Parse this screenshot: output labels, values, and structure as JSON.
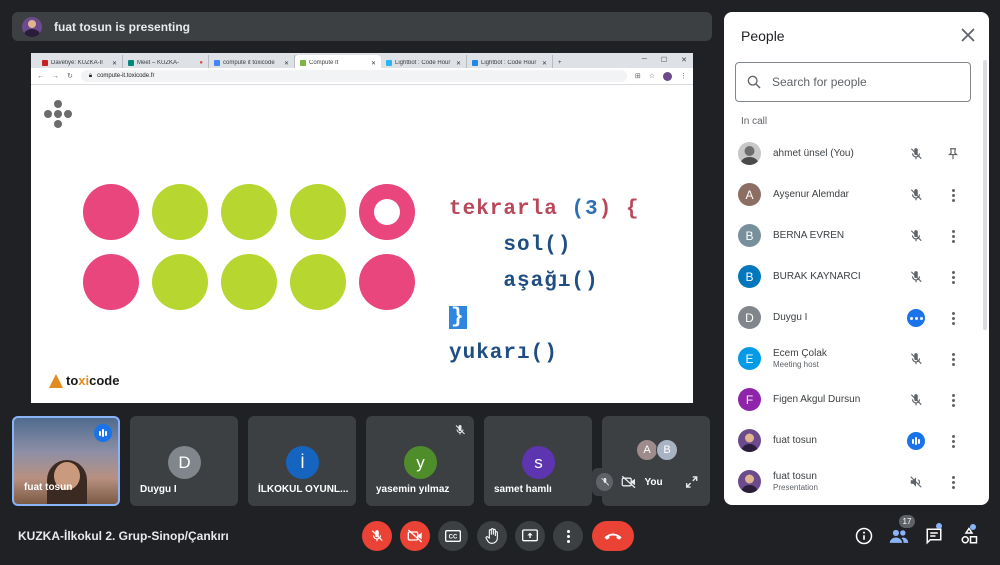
{
  "presenter_bar": {
    "text": "fuat tosun is presenting"
  },
  "shared_screen": {
    "tabs": [
      {
        "label": "Davetiye: KUZKA-İl"
      },
      {
        "label": "Meet – KUZKA-"
      },
      {
        "label": "compute it toxicode"
      },
      {
        "label": "Compute It"
      },
      {
        "label": "Lightbot : Code Hour"
      },
      {
        "label": "Lightbot : Code Hour"
      }
    ],
    "url": "compute-it.toxicode.fr",
    "code": {
      "line1_kw": "tekrarla",
      "line1_open": "(",
      "line1_num": "3",
      "line1_close": ") {",
      "line2": "sol()",
      "line3": "aşağı()",
      "line4": "}",
      "line5": "yukarı()"
    },
    "logo": {
      "pre": "to",
      "accent": "xi",
      "post": "code"
    }
  },
  "tiles": [
    {
      "name": "fuat tosun"
    },
    {
      "name": "Duygu I",
      "initial": "D"
    },
    {
      "name": "İLKOKUL OYUNL...",
      "initial": "İ"
    },
    {
      "name": "yasemin yılmaz",
      "initial": "y"
    },
    {
      "name": "samet hamlı",
      "initial": "s"
    },
    {
      "name": "You",
      "initials": [
        "A",
        "B"
      ]
    }
  ],
  "people_panel": {
    "title": "People",
    "search_placeholder": "Search for people",
    "section": "In call",
    "participants": [
      {
        "name": "ahmet ünsel (You)"
      },
      {
        "name": "Ayşenur Alemdar",
        "initial": "A"
      },
      {
        "name": "BERNA EVREN",
        "initial": "B"
      },
      {
        "name": "BURAK KAYNARCI",
        "initial": "B"
      },
      {
        "name": "Duygu I",
        "initial": "D"
      },
      {
        "name": "Ecem Çolak",
        "initial": "E",
        "sub": "Meeting host"
      },
      {
        "name": "Figen Akgul Dursun",
        "initial": "F"
      },
      {
        "name": "fuat tosun"
      },
      {
        "name": "fuat tosun",
        "sub": "Presentation"
      }
    ]
  },
  "bottom_bar": {
    "meeting_title": "KUZKA-İlkokul 2. Grup-Sinop/Çankırı",
    "people_count": "17"
  },
  "colors": {
    "pink": "#e8467c",
    "green": "#b7d62f",
    "red_button": "#ea4335",
    "blue_accent": "#1a73e8"
  }
}
